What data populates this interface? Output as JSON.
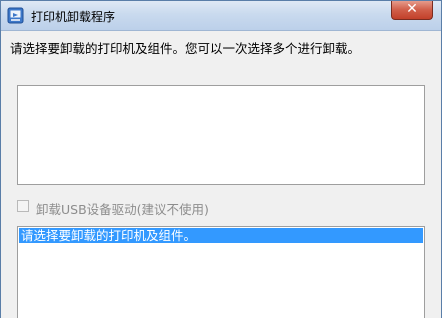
{
  "window": {
    "title": "打印机卸载程序",
    "close_symbol": "✕",
    "icon": "uninstaller-app-icon"
  },
  "instruction_text": "请选择要卸载的打印机及组件。您可以一次选择多个进行卸载。",
  "printer_list": {
    "items": []
  },
  "usb_driver_option": {
    "label": "卸载USB设备驱动(建议不使用)",
    "checked": false,
    "enabled": false
  },
  "component_list": {
    "items": [
      {
        "label": "请选择要卸载的打印机及组件。",
        "selected": true
      }
    ]
  }
}
